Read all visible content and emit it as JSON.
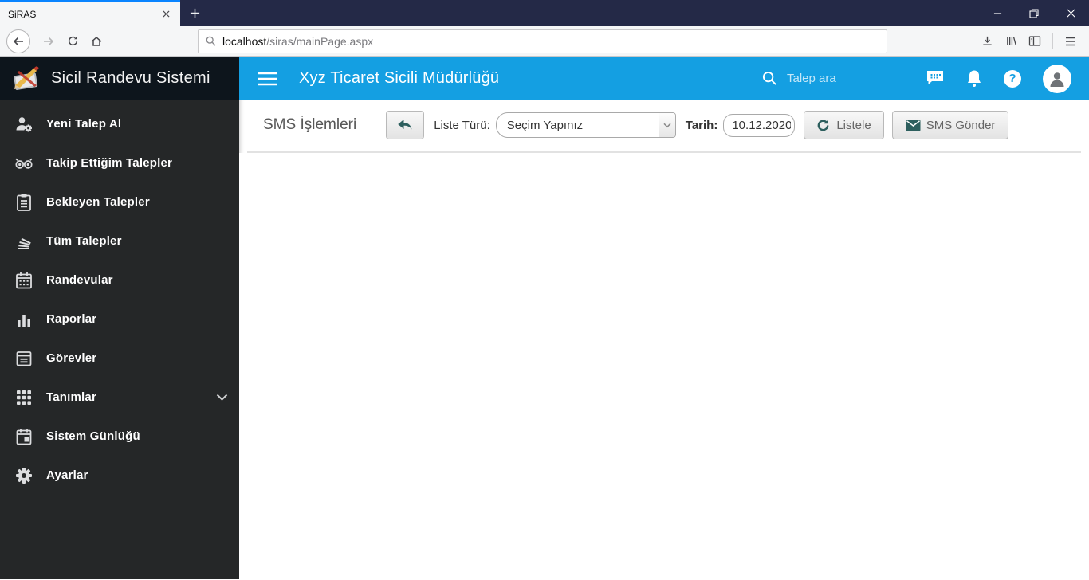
{
  "browser": {
    "tab_title": "SiRAS",
    "url_host": "localhost",
    "url_path": "/siras/mainPage.aspx"
  },
  "header": {
    "brand_title": "Sicil Randevu Sistemi",
    "office_title": "Xyz Ticaret Sicili Müdürlüğü",
    "search_placeholder": "Talep ara",
    "help_glyph": "?"
  },
  "sidebar": {
    "items": [
      {
        "label": "Yeni Talep Al",
        "icon": "user-gear-icon"
      },
      {
        "label": "Takip Ettiğim Talepler",
        "icon": "binoculars-icon"
      },
      {
        "label": "Bekleyen Talepler",
        "icon": "clipboard-icon"
      },
      {
        "label": "Tüm Talepler",
        "icon": "paper-stack-icon"
      },
      {
        "label": "Randevular",
        "icon": "calendar-icon"
      },
      {
        "label": "Raporlar",
        "icon": "bar-chart-icon"
      },
      {
        "label": "Görevler",
        "icon": "task-note-icon"
      },
      {
        "label": "Tanımlar",
        "icon": "grid-icon",
        "expandable": true
      },
      {
        "label": "Sistem Günlüğü",
        "icon": "calendar-log-icon"
      },
      {
        "label": "Ayarlar",
        "icon": "gear-icon"
      }
    ]
  },
  "content": {
    "page_title": "SMS İşlemleri",
    "list_type_label": "Liste Türü:",
    "list_type_value": "Seçim Yapınız",
    "date_label": "Tarih:",
    "date_value": "10.12.2020",
    "list_button_label": "Listele",
    "sms_button_label": "SMS Gönder"
  },
  "colors": {
    "firefox_accent": "#0a84ff",
    "tabbar_navy": "#242947",
    "brand_dark": "#0d151c",
    "header_blue": "#149fe2",
    "sidebar_dark": "#252728",
    "accent_teal": "#2d5f5e"
  }
}
